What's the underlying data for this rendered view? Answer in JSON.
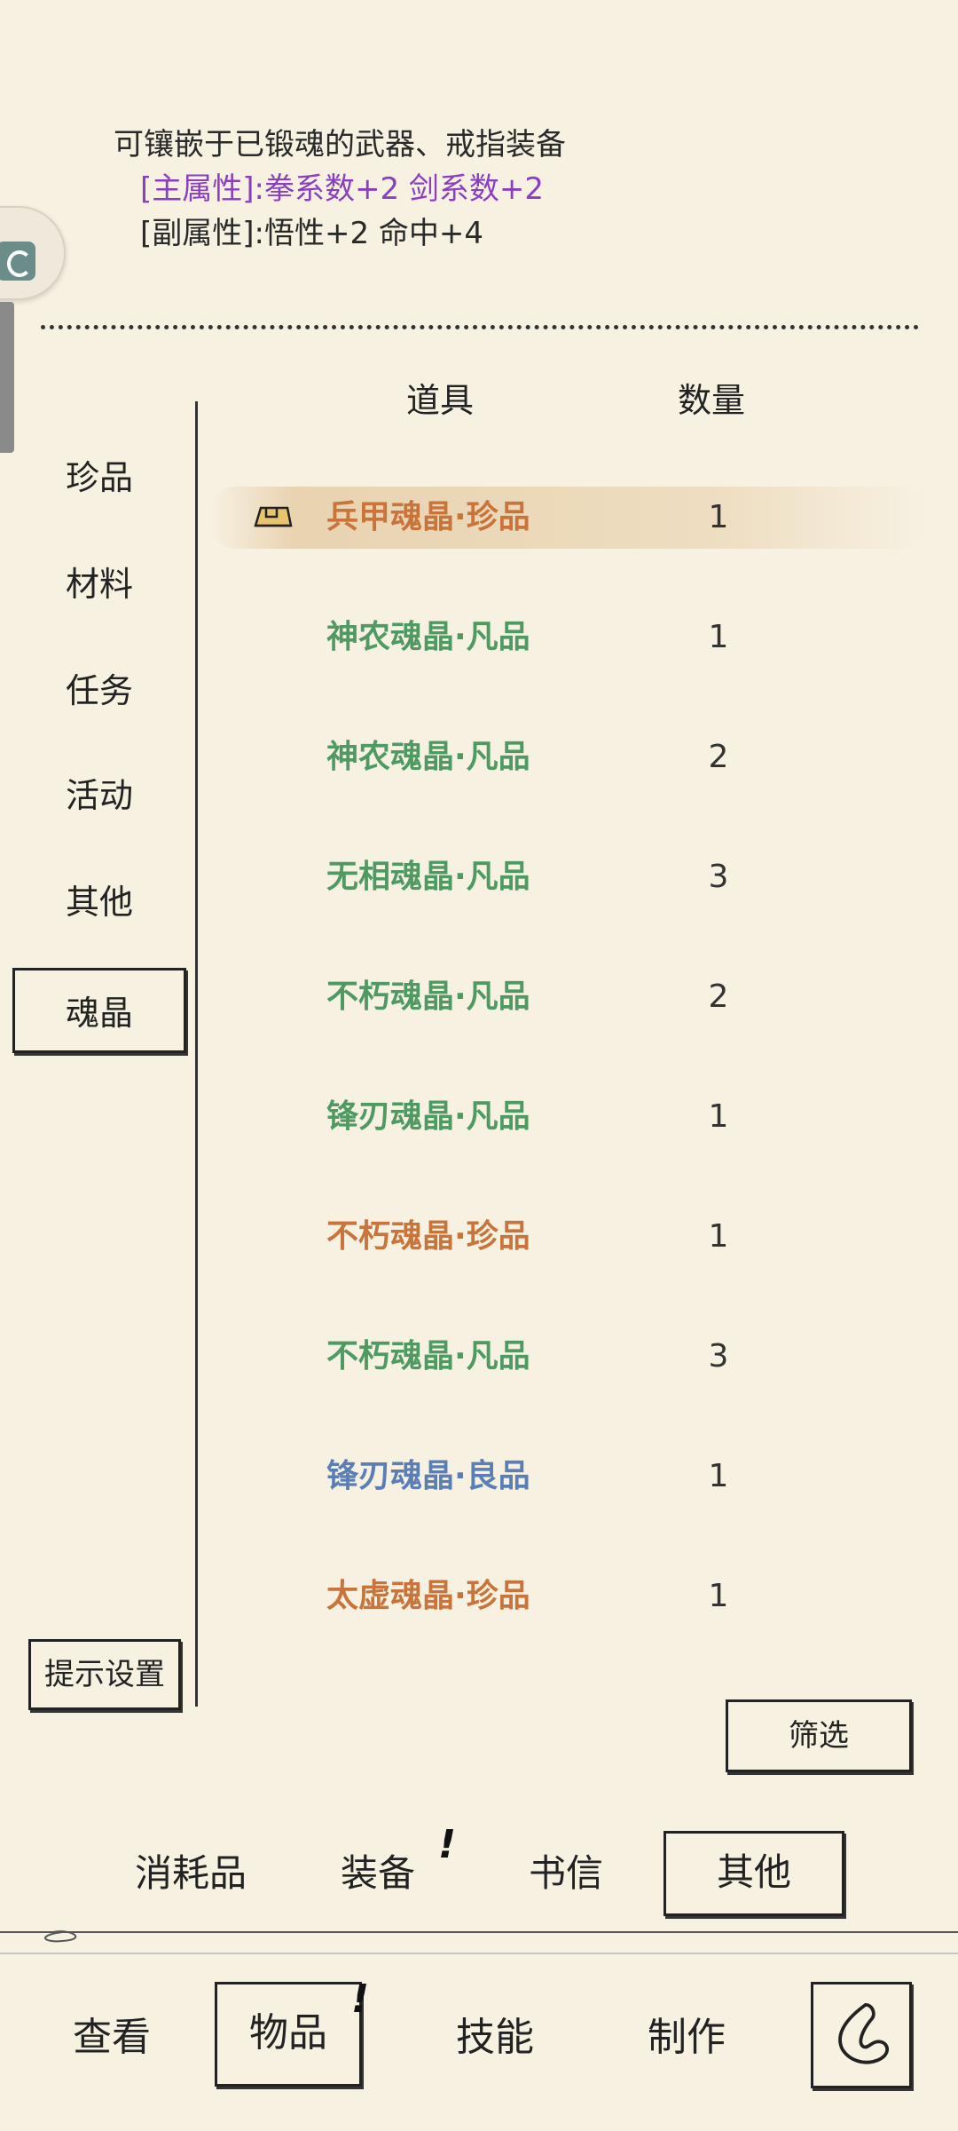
{
  "description": {
    "line1": "可镶嵌于已锻魂的武器、戒指装备",
    "main_attr": "[主属性]:拳系数+2 剑系数+2",
    "sub_attr": "[副属性]:悟性+2 命中+4"
  },
  "table": {
    "col_item": "道具",
    "col_qty": "数量"
  },
  "sidebar": {
    "items": [
      {
        "label": "珍品"
      },
      {
        "label": "材料"
      },
      {
        "label": "任务"
      },
      {
        "label": "活动"
      },
      {
        "label": "其他"
      },
      {
        "label": "魂晶"
      }
    ],
    "active": "魂晶",
    "hint_settings": "提示设置"
  },
  "items": [
    {
      "name": "兵甲魂晶·珍品",
      "qty": "1",
      "grade": "rare"
    },
    {
      "name": "神农魂晶·凡品",
      "qty": "1",
      "grade": "common"
    },
    {
      "name": "神农魂晶·凡品",
      "qty": "2",
      "grade": "common"
    },
    {
      "name": "无相魂晶·凡品",
      "qty": "3",
      "grade": "common"
    },
    {
      "name": "不朽魂晶·凡品",
      "qty": "2",
      "grade": "common"
    },
    {
      "name": "锋刃魂晶·凡品",
      "qty": "1",
      "grade": "common"
    },
    {
      "name": "不朽魂晶·珍品",
      "qty": "1",
      "grade": "rare"
    },
    {
      "name": "不朽魂晶·凡品",
      "qty": "3",
      "grade": "common"
    },
    {
      "name": "锋刃魂晶·良品",
      "qty": "1",
      "grade": "good"
    },
    {
      "name": "太虚魂晶·珍品",
      "qty": "1",
      "grade": "rare"
    }
  ],
  "grade_colors": {
    "rare": "#c8743a",
    "common": "#4f9a62",
    "good": "#5b7fb5"
  },
  "filter_label": "筛选",
  "categories": {
    "consumables": "消耗品",
    "equipment": "装备",
    "letters": "书信",
    "other": "其他",
    "alert_mark": "!"
  },
  "nav": {
    "view": "查看",
    "items": "物品",
    "skills": "技能",
    "craft": "制作"
  }
}
